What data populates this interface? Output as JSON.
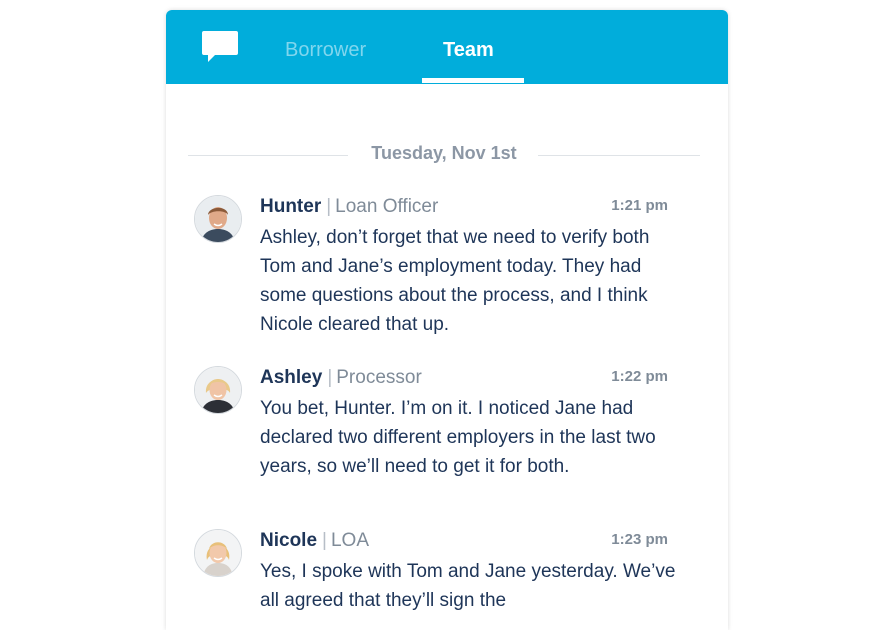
{
  "header": {
    "icon": "chat-bubble-icon",
    "tabs": [
      {
        "label": "Borrower",
        "active": false
      },
      {
        "label": "Team",
        "active": true
      }
    ],
    "color": "#01addb"
  },
  "day_separator": "Tuesday, Nov 1st",
  "messages": [
    {
      "name": "Hunter",
      "role": "Loan Officer",
      "time": "1:21 pm",
      "text": "Ashley, don’t forget that we need to verify both Tom and Jane’s employment today. They had some questions about the process, and I think Nicole cleared that up.",
      "avatar": "male-avatar"
    },
    {
      "name": "Ashley",
      "role": "Processor",
      "time": "1:22 pm",
      "text": "You bet, Hunter. I’m on it. I noticed Jane had declared two different employers in the last two years, so we’ll need to get it for both.",
      "avatar": "female-avatar"
    },
    {
      "name": "Nicole",
      "role": "LOA",
      "time": "1:23 pm",
      "text": "Yes, I spoke with Tom and Jane yesterday. We’ve all agreed that they’ll sign the",
      "avatar": "female-avatar"
    }
  ]
}
